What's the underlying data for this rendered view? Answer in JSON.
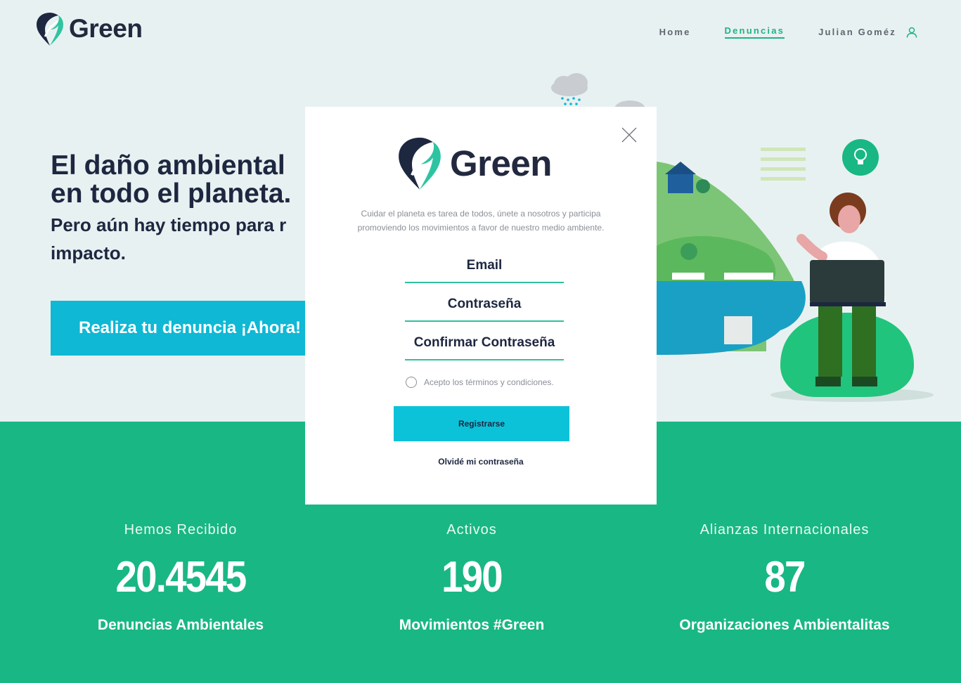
{
  "header": {
    "brand": "Green",
    "nav": {
      "home": "Home",
      "denuncias": "Denuncias",
      "user": "Julian Goméz"
    },
    "user_icon": "user-icon"
  },
  "hero": {
    "title_line1": "El daño ambiental",
    "title_line2": "en todo el planeta.",
    "subtitle_line1": "Pero aún hay tiempo para r",
    "subtitle_line2": "impacto.",
    "cta": "Realiza tu denuncia ¡Ahora!"
  },
  "stats": [
    {
      "label": "Hemos Recibido",
      "value": "20.4545",
      "caption": "Denuncias Ambientales"
    },
    {
      "label": "Activos",
      "value": "190",
      "caption": "Movimientos #Green"
    },
    {
      "label": "Alianzas Internacionales",
      "value": "87",
      "caption": "Organizaciones Ambientalitas"
    }
  ],
  "modal": {
    "brand": "Green",
    "description_line1": "Cuidar el planeta es tarea de todos, únete a nosotros y participa",
    "description_line2": "promoviendo los movimientos a favor de nuestro medio ambiente.",
    "email_placeholder": "Email",
    "password_placeholder": "Contraseña",
    "confirm_placeholder": "Confirmar Contraseña",
    "terms": "Acepto los términos y condiciones.",
    "register": "Registrarse",
    "forgot": "Olvidé mi contraseña"
  },
  "colors": {
    "accent_green": "#19b783",
    "accent_cyan": "#0fb8d4",
    "navy": "#1d2740",
    "background": "#e8f1f1"
  }
}
